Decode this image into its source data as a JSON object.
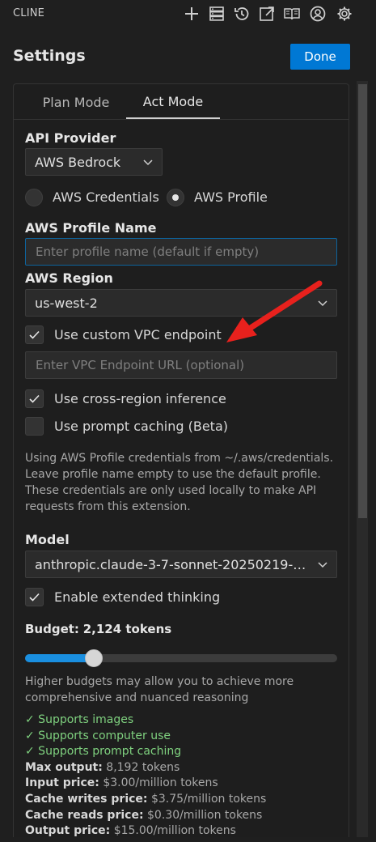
{
  "app": {
    "title": "CLINE"
  },
  "header": {
    "title": "Settings",
    "done_label": "Done"
  },
  "toolbar_icons": [
    "plus-icon",
    "server-icon",
    "history-icon",
    "popout-icon",
    "book-icon",
    "account-icon",
    "gear-icon"
  ],
  "tabs": [
    {
      "label": "Plan Mode",
      "active": false
    },
    {
      "label": "Act Mode",
      "active": true
    }
  ],
  "api_provider": {
    "label": "API Provider",
    "value": "AWS Bedrock"
  },
  "auth": {
    "options": [
      {
        "label": "AWS Credentials",
        "checked": false
      },
      {
        "label": "AWS Profile",
        "checked": true
      }
    ]
  },
  "profile_name": {
    "label": "AWS Profile Name",
    "value": "",
    "placeholder": "Enter profile name (default if empty)"
  },
  "region": {
    "label": "AWS Region",
    "value": "us-west-2"
  },
  "vpc": {
    "label": "Use custom VPC endpoint",
    "checked": true,
    "placeholder": "Enter VPC Endpoint URL (optional)",
    "value": ""
  },
  "cross_region": {
    "label": "Use cross-region inference",
    "checked": true
  },
  "prompt_caching": {
    "label": "Use prompt caching (Beta)",
    "checked": false
  },
  "profile_help": "Using AWS Profile credentials from ~/.aws/credentials. Leave profile name empty to use the default profile. These credentials are only used locally to make API requests from this extension.",
  "model": {
    "label": "Model",
    "value": "anthropic.claude-3-7-sonnet-20250219-…"
  },
  "extended_thinking": {
    "label": "Enable extended thinking",
    "checked": true
  },
  "budget": {
    "label": "Budget:",
    "value": "2,124 tokens",
    "fraction": 0.22,
    "help": "Higher budgets may allow you to achieve more comprehensive and nuanced reasoning"
  },
  "features": [
    "✓ Supports images",
    "✓ Supports computer use",
    "✓ Supports prompt caching"
  ],
  "model_info": [
    {
      "key": "Max output:",
      "value": "8,192 tokens"
    },
    {
      "key": "Input price:",
      "value": "$3.00/million tokens"
    },
    {
      "key": "Cache writes price:",
      "value": "$3.75/million tokens"
    },
    {
      "key": "Cache reads price:",
      "value": "$0.30/million tokens"
    },
    {
      "key": "Output price:",
      "value": "$15.00/million tokens"
    }
  ],
  "annotation": {
    "type": "red-arrow",
    "target": "vpc-endpoint-checkbox",
    "color": "#e8211d"
  },
  "colors": {
    "accent": "#0078d4",
    "feature_green": "#7fd17f",
    "slider_fill": "#1a8fe0"
  }
}
